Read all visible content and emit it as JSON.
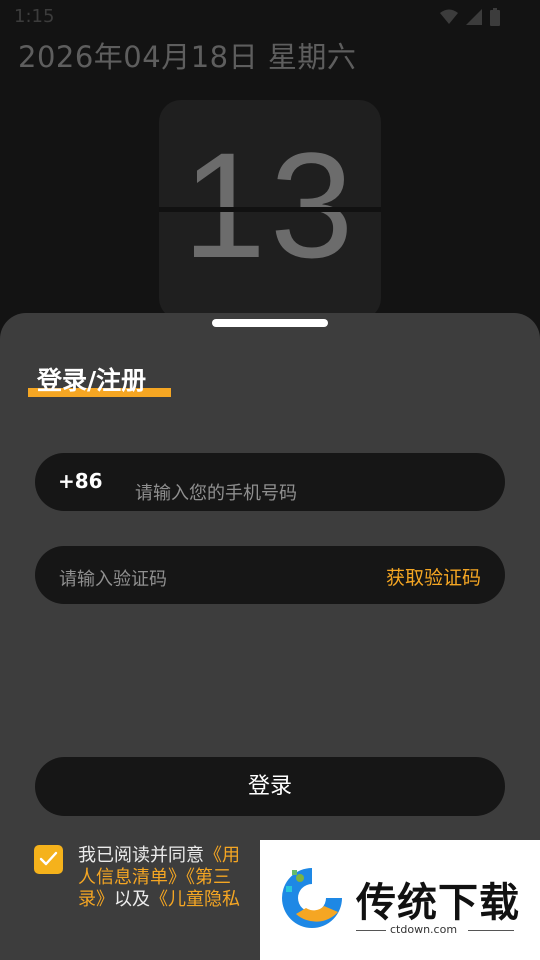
{
  "status_bar": {
    "time": "1:15",
    "icons": [
      "wifi-icon",
      "signal-icon",
      "battery-icon"
    ]
  },
  "clock": {
    "date": "2026年04月18日 星期六",
    "digits": "13"
  },
  "login": {
    "title": "登录/注册",
    "country_code": "+86",
    "phone_placeholder": "请输入您的手机号码",
    "code_placeholder": "请输入验证码",
    "get_code_label": "获取验证码",
    "submit_label": "登录"
  },
  "agreement": {
    "checked": true,
    "prefix": "我已阅读并同意",
    "link1": "《用",
    "link2": "人信息清单》《第三",
    "line3_link": "录》",
    "middle": "以及",
    "link3": "《儿童隐私"
  },
  "watermark": {
    "name": "传统下载",
    "url": "ctdown.com"
  },
  "colors": {
    "accent": "#f5a623",
    "sheet": "#3d3d3d",
    "field": "#161616"
  }
}
